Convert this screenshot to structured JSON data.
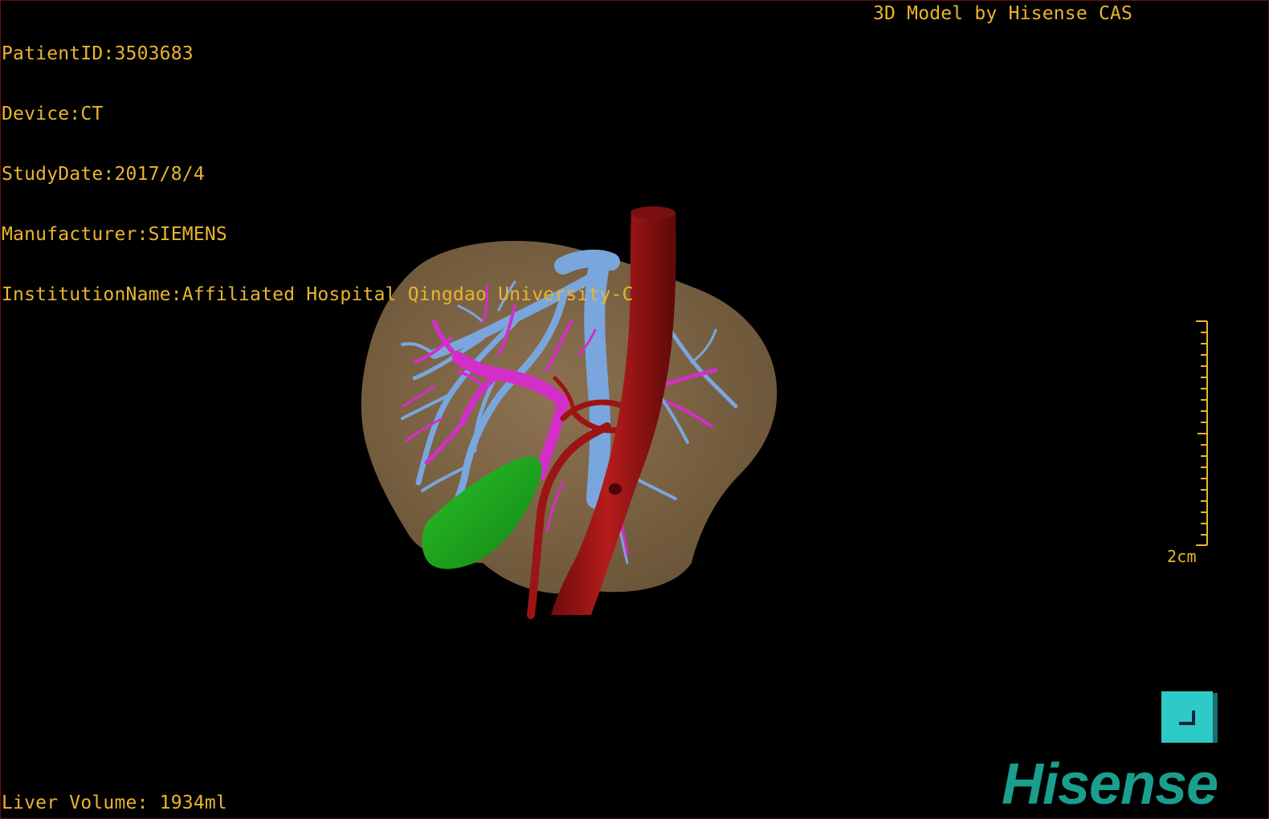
{
  "patient_info": {
    "patient_id_label": "PatientID:",
    "patient_id": "3503683",
    "device_label": "Device:",
    "device": "CT",
    "study_date_label": "StudyDate:",
    "study_date": "2017/8/4",
    "manufacturer_label": "Manufacturer:",
    "manufacturer": "SIEMENS",
    "institution_label": "InstitutionName:",
    "institution": "Affiliated Hospital Qingdao University-C"
  },
  "header_right": "3D Model by Hisense CAS",
  "liver_volume": {
    "label": "Liver Volume: ",
    "value": "1934ml"
  },
  "scale_bar": {
    "label": "2cm"
  },
  "logo_text": "Hisense",
  "colors": {
    "overlay_text": "#e8b52e",
    "liver": "#8a6f4e",
    "hepatic_vein": "#7aa6de",
    "portal_vein": "#d42ec9",
    "artery_ivc": "#9c1414",
    "gallbladder": "#1ea31e",
    "reset_button": "#2ec9c9",
    "logo": "#1a9e8e"
  },
  "icons": {
    "reset_view": "corner-reset-icon"
  }
}
